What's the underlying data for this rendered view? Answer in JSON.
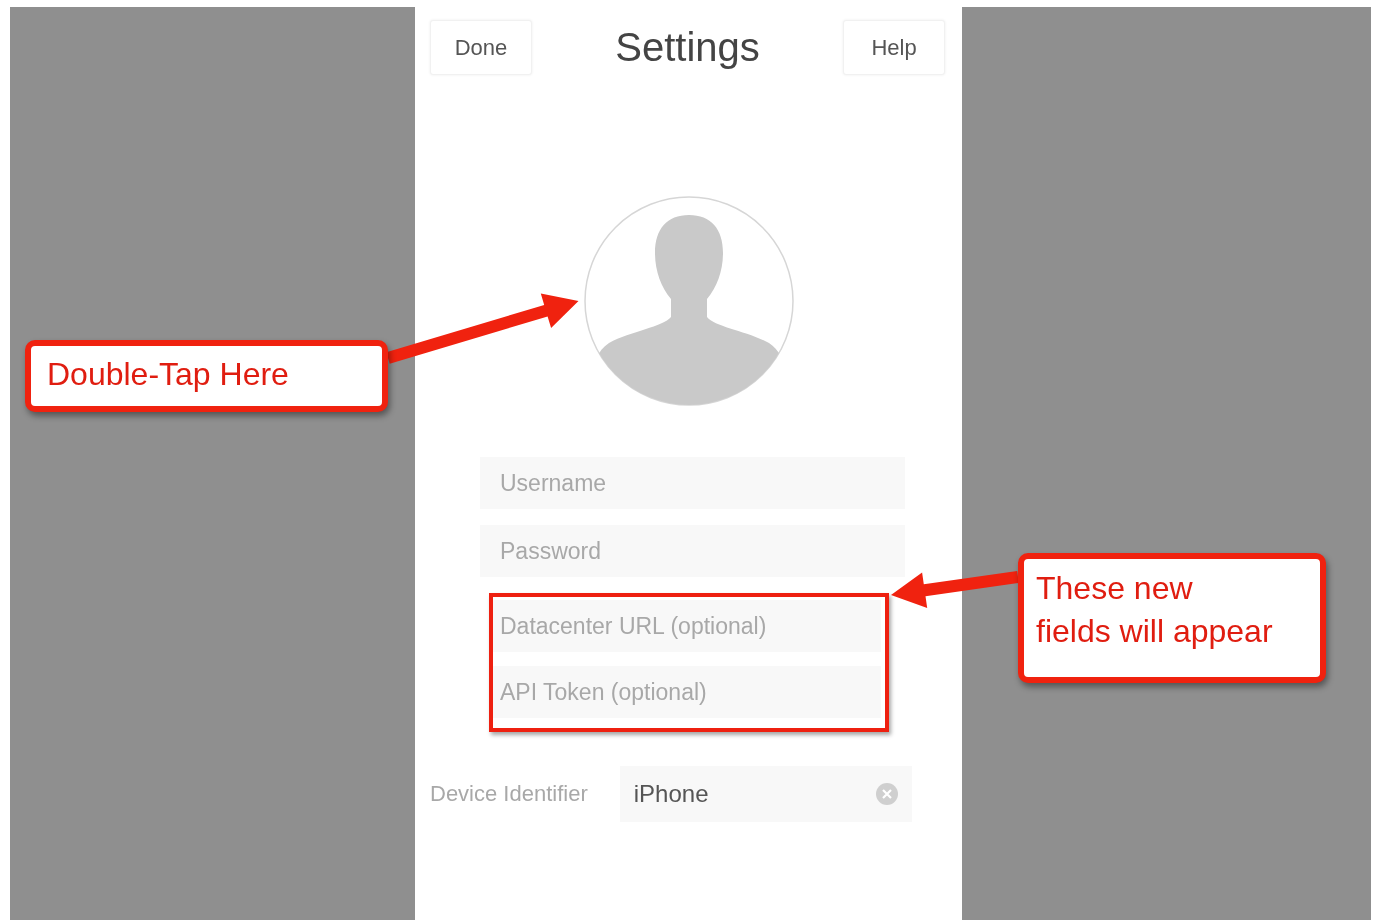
{
  "header": {
    "left_button": "Done",
    "title": "Settings",
    "right_button": "Help"
  },
  "fields": [
    {
      "placeholder": "Username",
      "highlighted": false
    },
    {
      "placeholder": "Password",
      "highlighted": false
    },
    {
      "placeholder": "Datacenter URL (optional)",
      "highlighted": true
    },
    {
      "placeholder": "API Token (optional)",
      "highlighted": true
    }
  ],
  "device_identifier": {
    "label": "Device Identifier",
    "value": "iPhone"
  },
  "callouts": [
    {
      "lines": [
        "Double-Tap Here"
      ]
    },
    {
      "lines": [
        "These new",
        "fields will appear"
      ]
    }
  ]
}
